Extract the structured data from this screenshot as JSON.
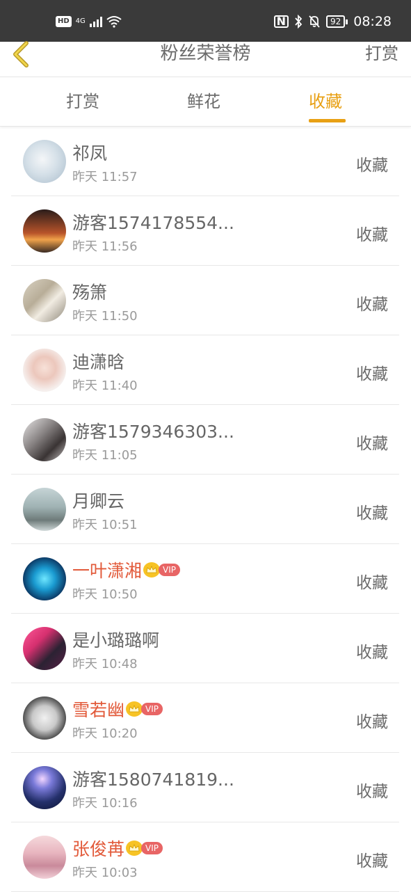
{
  "status_bar": {
    "hd": "HD",
    "network": "4G",
    "battery": "92",
    "time": "08:28"
  },
  "nav": {
    "title": "粉丝荣誉榜",
    "action": "打赏"
  },
  "tabs": [
    {
      "label": "打赏",
      "active": false
    },
    {
      "label": "鲜花",
      "active": false
    },
    {
      "label": "收藏",
      "active": true
    }
  ],
  "colors": {
    "accent": "#e8a014",
    "vip_name": "#e25a3a",
    "vip_tag": "#e86565"
  },
  "vip_label": "VIP",
  "items": [
    {
      "name": "祁凤",
      "time": "昨天 11:57",
      "action": "收藏",
      "vip": false
    },
    {
      "name": "游客1574178554...",
      "time": "昨天 11:56",
      "action": "收藏",
      "vip": false
    },
    {
      "name": "殇箫",
      "time": "昨天 11:50",
      "action": "收藏",
      "vip": false
    },
    {
      "name": "迪潇晗",
      "time": "昨天 11:40",
      "action": "收藏",
      "vip": false
    },
    {
      "name": "游客1579346303...",
      "time": "昨天 11:05",
      "action": "收藏",
      "vip": false
    },
    {
      "name": "月卿云",
      "time": "昨天 10:51",
      "action": "收藏",
      "vip": false
    },
    {
      "name": "一叶潇湘",
      "time": "昨天 10:50",
      "action": "收藏",
      "vip": true
    },
    {
      "name": "是小璐璐啊",
      "time": "昨天 10:48",
      "action": "收藏",
      "vip": false
    },
    {
      "name": "雪若幽",
      "time": "昨天 10:20",
      "action": "收藏",
      "vip": true
    },
    {
      "name": "游客1580741819...",
      "time": "昨天 10:16",
      "action": "收藏",
      "vip": false
    },
    {
      "name": "张俊苒",
      "time": "昨天 10:03",
      "action": "收藏",
      "vip": true
    }
  ]
}
